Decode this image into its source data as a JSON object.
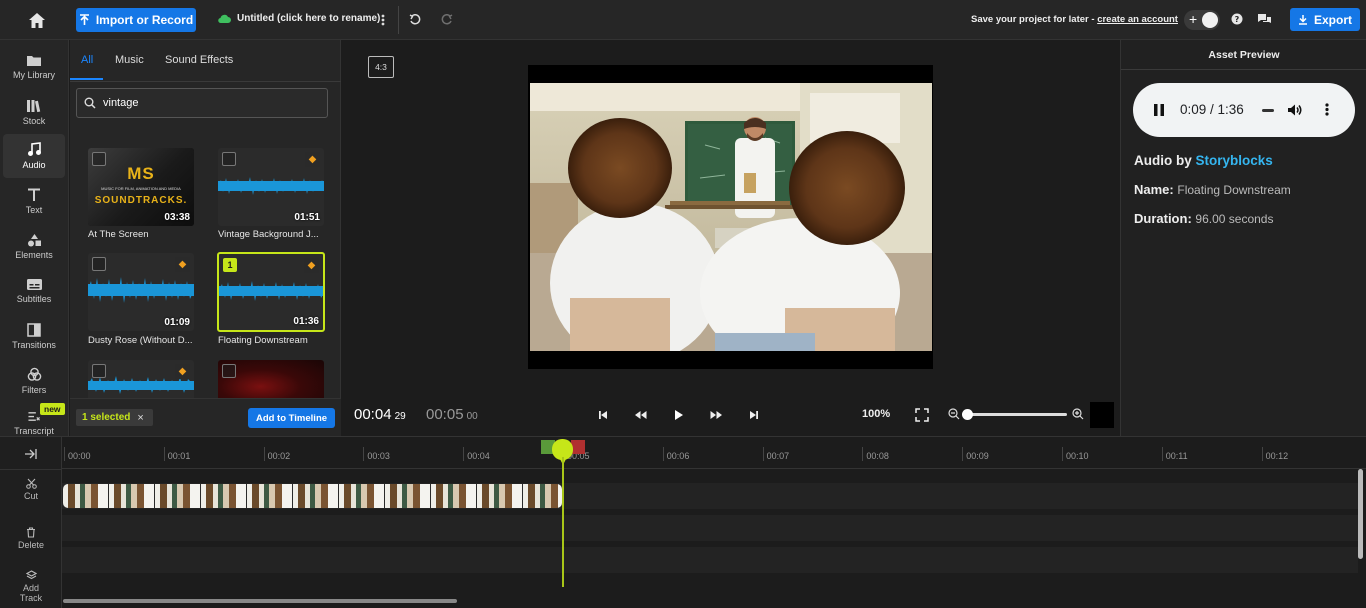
{
  "topbar": {
    "import_label": "Import or Record",
    "project_title": "Untitled (click here to rename)",
    "save_text": "Save your project for later - ",
    "create_account": "create an account",
    "export_label": "Export",
    "colors": {
      "accent": "#1577e6",
      "cloud": "#3fbf5f"
    }
  },
  "rail": {
    "items": [
      {
        "label": "My Library",
        "icon": "folder-icon"
      },
      {
        "label": "Stock",
        "icon": "stock-icon"
      },
      {
        "label": "Audio",
        "icon": "music-note-icon"
      },
      {
        "label": "Text",
        "icon": "text-icon"
      },
      {
        "label": "Elements",
        "icon": "shapes-icon"
      },
      {
        "label": "Subtitles",
        "icon": "subtitles-icon"
      },
      {
        "label": "Transitions",
        "icon": "transitions-icon"
      },
      {
        "label": "Filters",
        "icon": "filters-icon"
      },
      {
        "label": "Transcript",
        "icon": "transcript-icon"
      }
    ],
    "new_badge": "new"
  },
  "library": {
    "tabs": [
      "All",
      "Music",
      "Sound Effects"
    ],
    "search_value": "vintage",
    "tiles": [
      {
        "label": "At The Screen",
        "duration": "03:38",
        "cover_line1": "MS",
        "cover_line2": "SOUNDTRACKS.",
        "cover_small": "MUSIC FOR FILM, ANIMATION AND MEDIA"
      },
      {
        "label": "Vintage Background J...",
        "duration": "01:51"
      },
      {
        "label": "Dusty Rose (Without D...",
        "duration": "01:09"
      },
      {
        "label": "Floating Downstream",
        "duration": "01:36",
        "selected_index": "1"
      }
    ],
    "selected_text": "1 selected",
    "add_to_timeline": "Add to Timeline"
  },
  "preview": {
    "aspect": "4:3",
    "current_time": "00:04",
    "current_frames": "29",
    "total_time": "00:05",
    "total_frames": "00",
    "zoom": "100%"
  },
  "asset": {
    "title": "Asset Preview",
    "player_time": "0:09 / 1:36",
    "audio_by": "Audio by ",
    "provider": "Storyblocks",
    "name_label": "Name:",
    "name_value": "Floating Downstream",
    "duration_label": "Duration:",
    "duration_value": "96.00 seconds"
  },
  "timeline": {
    "ticks": [
      "00:00",
      "00:01",
      "00:02",
      "00:03",
      "00:04",
      "00:05",
      "00:06",
      "00:07",
      "00:08",
      "00:09",
      "00:10",
      "00:11",
      "00:12"
    ],
    "tools": [
      "Cut",
      "Delete",
      "Add Track"
    ]
  }
}
